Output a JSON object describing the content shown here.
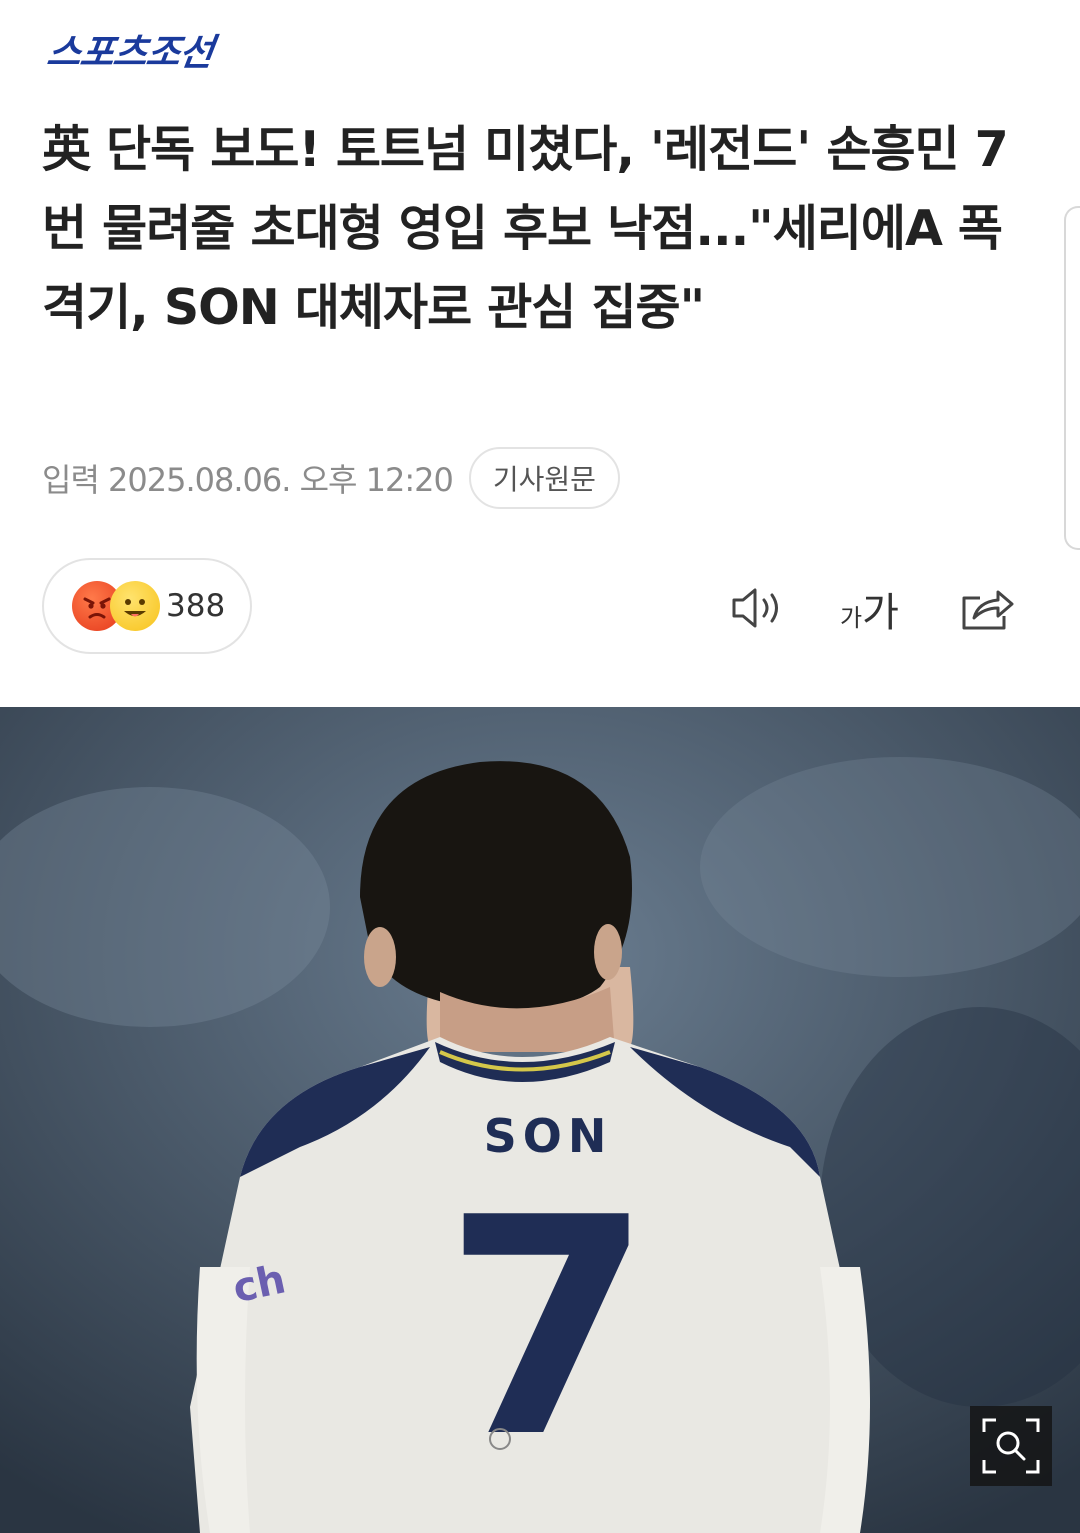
{
  "header": {
    "logo": "스포츠조선"
  },
  "article": {
    "headline": "英 단독 보도! 토트넘 미쳤다, '레전드' 손흥민 7번 물려줄 초대형 영입 후보 낙점...\"세리에A 폭격기, SON 대체자로 관심 집중\"",
    "date": "입력 2025.08.06. 오후 12:20",
    "original_button": "기사원문"
  },
  "reactions": {
    "count": "388"
  },
  "toolbar": {
    "speaker_icon": "speaker-icon",
    "font_small": "가",
    "font_big": "가",
    "share_icon": "share-icon"
  },
  "photo": {
    "jersey_name": "SON",
    "jersey_number": "7",
    "sleeve_text": "ch",
    "zoom_icon": "zoom-icon"
  },
  "colors": {
    "logo": "#1a3a9c",
    "headline": "#222222",
    "meta": "#8b8b8b",
    "jersey_navy": "#1f2d55"
  }
}
